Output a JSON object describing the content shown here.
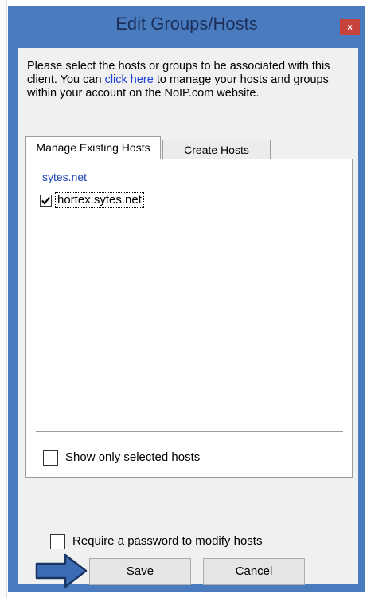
{
  "window": {
    "title": "Edit Groups/Hosts",
    "close_symbol": "×"
  },
  "intro": {
    "text_before": "Please select the hosts or groups to be associated with this client. You can ",
    "link_text": "click here",
    "text_after": " to manage your hosts and groups within your account on the NoIP.com website."
  },
  "tabs": [
    {
      "label": "Manage Existing Hosts",
      "active": true
    },
    {
      "label": "Create Hosts",
      "active": false
    }
  ],
  "groups": [
    {
      "name": "sytes.net",
      "hosts": [
        {
          "label": "hortex.sytes.net",
          "checked": true
        }
      ]
    }
  ],
  "options": {
    "show_only_selected": {
      "label": "Show only selected hosts",
      "checked": false
    },
    "require_password": {
      "label": "Require a password to modify hosts",
      "checked": false
    }
  },
  "buttons": {
    "save": "Save",
    "cancel": "Cancel"
  },
  "colors": {
    "title_bar": "#4a7bbf",
    "close_button": "#c7423a",
    "link": "#1d3fd4",
    "group_header": "#1e44b4",
    "arrow_fill": "#3c6cb4"
  },
  "icons": {
    "close": "close-icon",
    "checkmark": "checkmark-icon",
    "arrow": "right-arrow-icon"
  }
}
